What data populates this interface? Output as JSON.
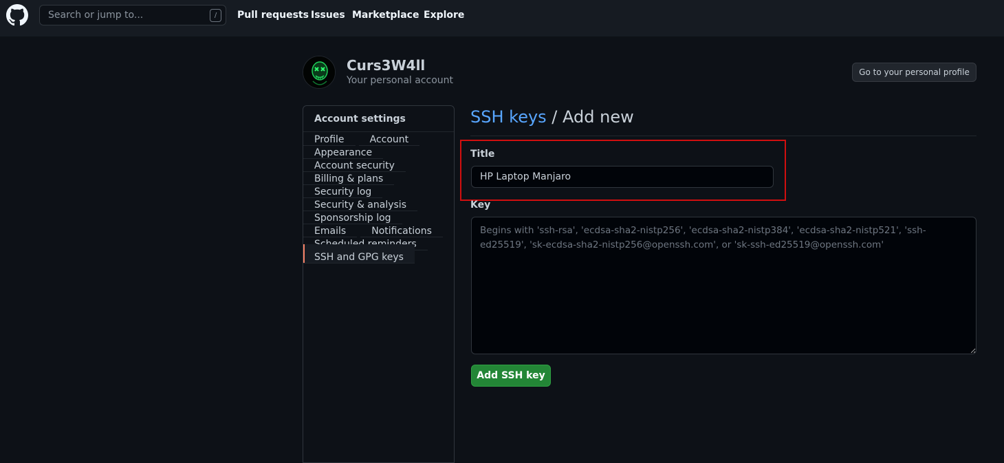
{
  "header": {
    "search_placeholder": "Search or jump to...",
    "search_shortcut": "/",
    "nav": [
      "Pull requests",
      "Issues",
      "Marketplace",
      "Explore"
    ]
  },
  "account": {
    "name": "Curs3W4ll",
    "subtitle": "Your personal account",
    "profile_button": "Go to your personal profile"
  },
  "sidebar": {
    "heading": "Account settings",
    "items": [
      {
        "label": "Profile"
      },
      {
        "label": "Account"
      },
      {
        "label": "Appearance"
      },
      {
        "label": "Account security"
      },
      {
        "label": "Billing & plans"
      },
      {
        "label": "Security log"
      },
      {
        "label": "Security & analysis"
      },
      {
        "label": "Sponsorship log"
      },
      {
        "label": "Emails"
      },
      {
        "label": "Notifications"
      },
      {
        "label": "Scheduled reminders"
      },
      {
        "label": "SSH and GPG keys",
        "selected": true
      }
    ]
  },
  "main": {
    "breadcrumb": "SSH keys",
    "title_suffix": " / Add new",
    "title_label": "Title",
    "title_value": "HP Laptop Manjaro",
    "key_label": "Key",
    "key_placeholder": "Begins with 'ssh-rsa', 'ecdsa-sha2-nistp256', 'ecdsa-sha2-nistp384', 'ecdsa-sha2-nistp521', 'ssh-ed25519', 'sk-ecdsa-sha2-nistp256@openssh.com', or 'sk-ssh-ed25519@openssh.com'",
    "submit_label": "Add SSH key"
  },
  "colors": {
    "background": "#0d1117",
    "header": "#161b22",
    "link": "#58a6ff",
    "primary_button": "#238636",
    "selected_indicator": "#f78166",
    "highlight_box": "#d10f0f"
  }
}
